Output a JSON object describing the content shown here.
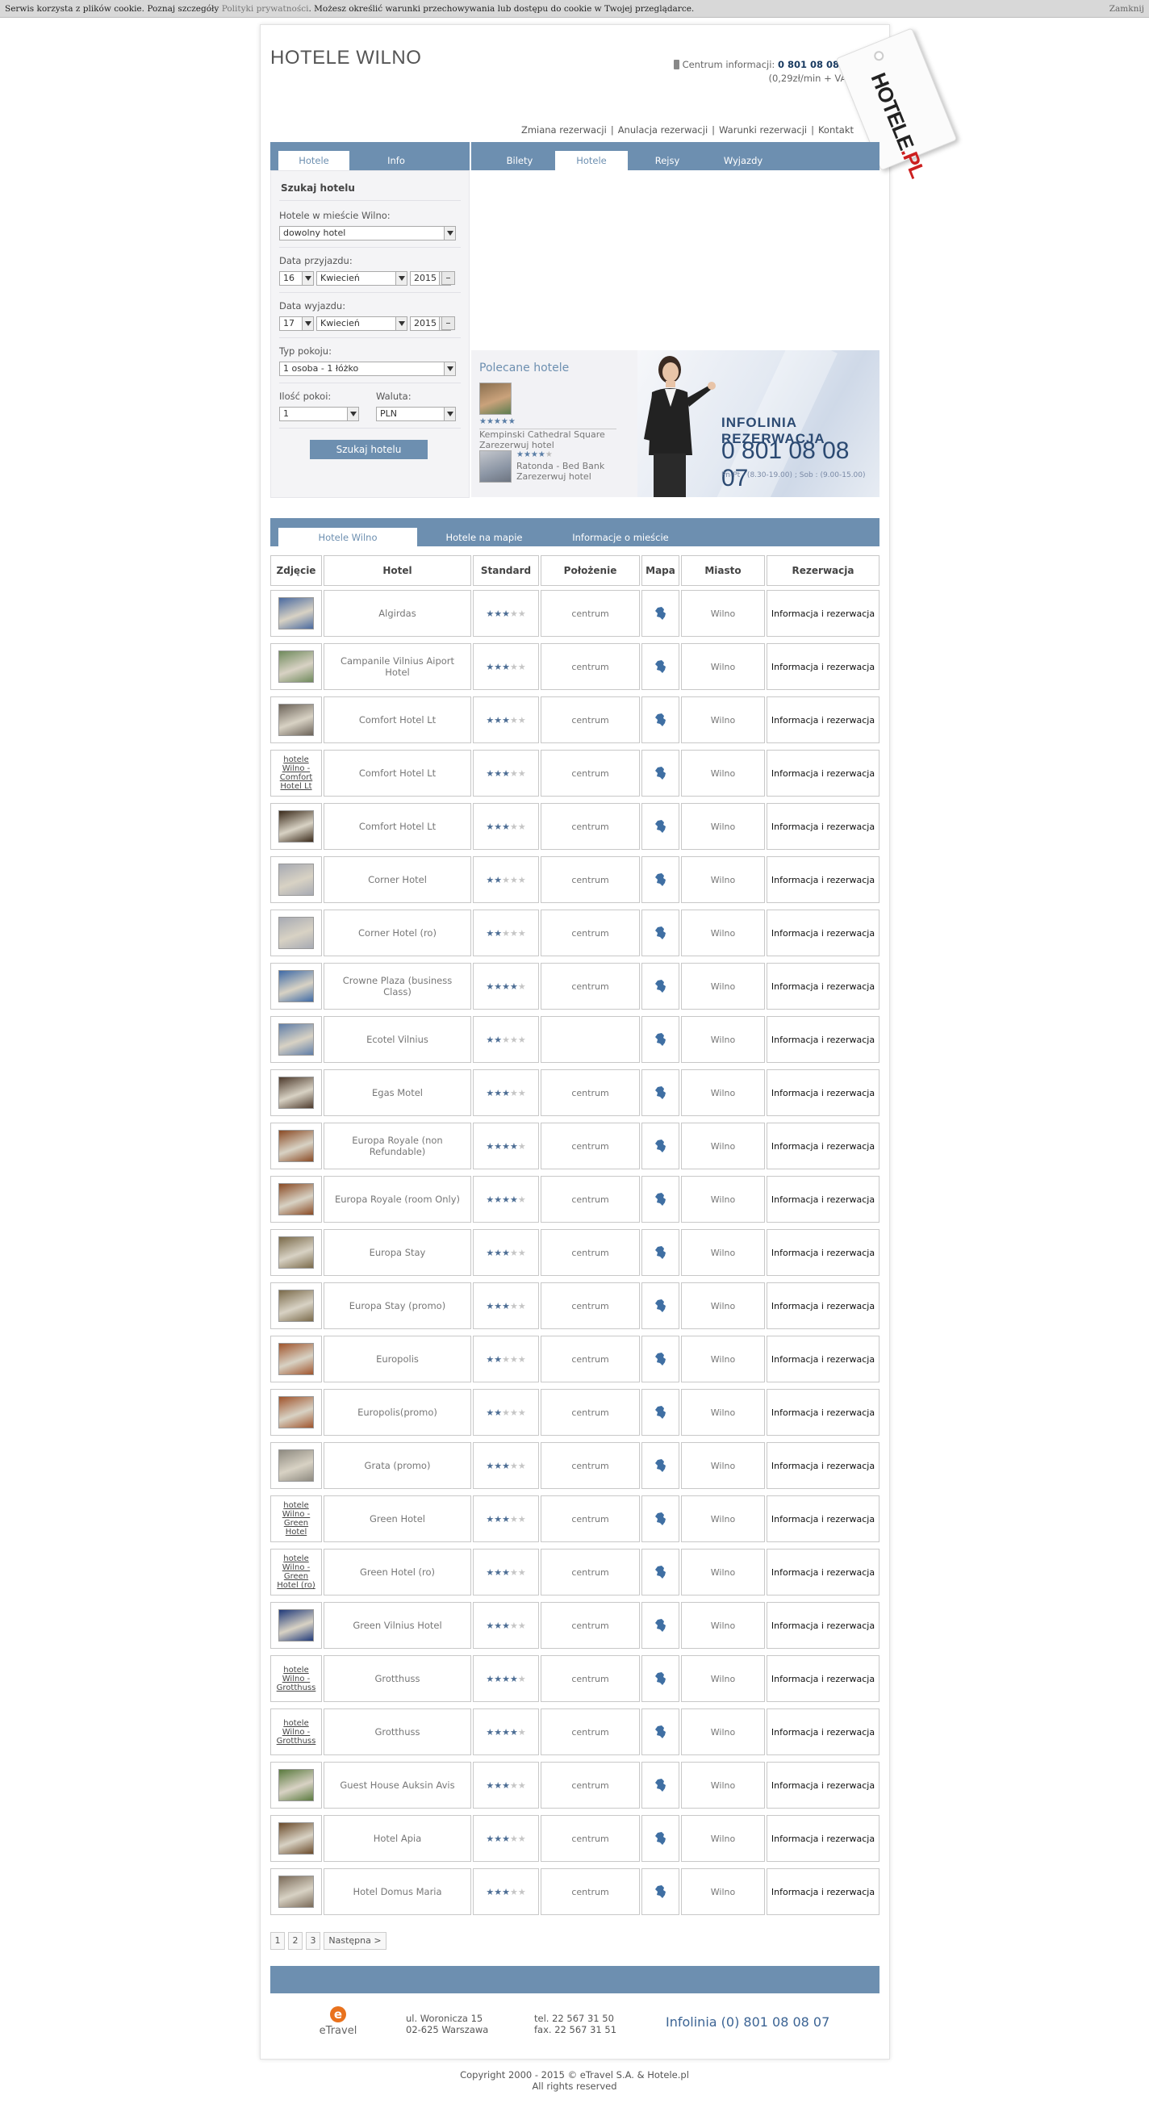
{
  "cookie": {
    "text_before": "Serwis korzysta z plików cookie. Poznaj szczegóły ",
    "link": "Polityki prywatności",
    "text_after": ". Możesz określić warunki przechowywania lub dostępu do cookie w Twojej przeglądarce.",
    "close": "Zamknij"
  },
  "header": {
    "title": "HOTELE WILNO",
    "contact_label": "Centrum informacji: ",
    "contact_phone": "0 801 08 08 07",
    "contact_price": "(0,29zł/min + VAT)",
    "logo_text": "HOTELE",
    "logo_suffix": ".PL"
  },
  "top_links": [
    "Zmiana rezerwacji",
    "Anulacja rezerwacji",
    "Warunki rezerwacji",
    "Kontakt"
  ],
  "left_tabs": [
    "Hotele",
    "Info"
  ],
  "right_tabs": [
    "Bilety",
    "Hotele",
    "Rejsy",
    "Wyjazdy"
  ],
  "search": {
    "title": "Szukaj hotelu",
    "hotel_label": "Hotele w mieście Wilno:",
    "hotel_value": "dowolny hotel",
    "arrival_label": "Data przyjazdu:",
    "arrival": {
      "day": "16",
      "month": "Kwiecień",
      "year": "2015"
    },
    "departure_label": "Data wyjazdu:",
    "departure": {
      "day": "17",
      "month": "Kwiecień",
      "year": "2015"
    },
    "room_type_label": "Typ pokoju:",
    "room_type": "1 osoba - 1 łóżko",
    "rooms_label": "Ilość pokoi:",
    "rooms": "1",
    "currency_label": "Waluta:",
    "currency": "PLN",
    "button": "Szukaj hotelu"
  },
  "recommended": {
    "title": "Polecane hotele",
    "items": [
      {
        "name": "Kempinski Cathedral Square",
        "action": "Zarezerwuj hotel",
        "stars": 5
      },
      {
        "name": "Ratonda - Bed Bank",
        "action": "Zarezerwuj hotel",
        "stars": 4
      }
    ]
  },
  "banner": {
    "title": "INFOLINIA REZERWACJA",
    "phone": "0 801 08 08 07",
    "hours": "Pn-Pt : (8.30-19.00) ;  Sob : (9.00-15.00)"
  },
  "list_tabs": [
    "Hotele Wilno",
    "Hotele na mapie",
    "Informacje o mieście"
  ],
  "table": {
    "headers": [
      "Zdjęcie",
      "Hotel",
      "Standard",
      "Położenie",
      "Mapa",
      "Miasto",
      "Rezerwacja"
    ],
    "reserve_label": "Informacja i rezerwacja",
    "rows": [
      {
        "photo": "img",
        "photo_alt": "",
        "name": "Algirdas",
        "stars": 3,
        "position": "centrum",
        "city": "Wilno",
        "img_color": "#4a6aa0"
      },
      {
        "photo": "img",
        "photo_alt": "",
        "name": "Campanile Vilnius Aiport Hotel",
        "stars": 3,
        "position": "centrum",
        "city": "Wilno",
        "img_color": "#6f8a5c"
      },
      {
        "photo": "img",
        "photo_alt": "",
        "name": "Comfort Hotel Lt",
        "stars": 3,
        "position": "centrum",
        "city": "Wilno",
        "img_color": "#6b6258"
      },
      {
        "photo": "alt",
        "photo_alt": "hotele Wilno - Comfort Hotel Lt",
        "name": "Comfort Hotel Lt",
        "stars": 3,
        "position": "centrum",
        "city": "Wilno",
        "img_color": ""
      },
      {
        "photo": "img",
        "photo_alt": "",
        "name": "Comfort Hotel Lt",
        "stars": 3,
        "position": "centrum",
        "city": "Wilno",
        "img_color": "#3a2a1a"
      },
      {
        "photo": "img",
        "photo_alt": "",
        "name": "Corner Hotel",
        "stars": 2,
        "position": "centrum",
        "city": "Wilno",
        "img_color": "#a7aab3"
      },
      {
        "photo": "img",
        "photo_alt": "",
        "name": "Corner Hotel (ro)",
        "stars": 2,
        "position": "centrum",
        "city": "Wilno",
        "img_color": "#a7aab3"
      },
      {
        "photo": "img",
        "photo_alt": "",
        "name": "Crowne Plaza (business Class)",
        "stars": 4,
        "position": "centrum",
        "city": "Wilno",
        "img_color": "#3e6aa6"
      },
      {
        "photo": "img",
        "photo_alt": "",
        "name": "Ecotel Vilnius",
        "stars": 2,
        "position": "",
        "city": "Wilno",
        "img_color": "#5f7ea8"
      },
      {
        "photo": "img",
        "photo_alt": "",
        "name": "Egas Motel",
        "stars": 3,
        "position": "centrum",
        "city": "Wilno",
        "img_color": "#4d3a2c"
      },
      {
        "photo": "img",
        "photo_alt": "",
        "name": "Europa Royale (non Refundable)",
        "stars": 4,
        "position": "centrum",
        "city": "Wilno",
        "img_color": "#8a4a24"
      },
      {
        "photo": "img",
        "photo_alt": "",
        "name": "Europa Royale (room Only)",
        "stars": 4,
        "position": "centrum",
        "city": "Wilno",
        "img_color": "#8a4a24"
      },
      {
        "photo": "img",
        "photo_alt": "",
        "name": "Europa Stay",
        "stars": 3,
        "position": "centrum",
        "city": "Wilno",
        "img_color": "#7a6a4a"
      },
      {
        "photo": "img",
        "photo_alt": "",
        "name": "Europa Stay (promo)",
        "stars": 3,
        "position": "centrum",
        "city": "Wilno",
        "img_color": "#7a6a4a"
      },
      {
        "photo": "img",
        "photo_alt": "",
        "name": "Europolis",
        "stars": 2,
        "position": "centrum",
        "city": "Wilno",
        "img_color": "#a0542c"
      },
      {
        "photo": "img",
        "photo_alt": "",
        "name": "Europolis(promo)",
        "stars": 2,
        "position": "centrum",
        "city": "Wilno",
        "img_color": "#a0542c"
      },
      {
        "photo": "img",
        "photo_alt": "",
        "name": "Grata (promo)",
        "stars": 3,
        "position": "centrum",
        "city": "Wilno",
        "img_color": "#8e8a80"
      },
      {
        "photo": "alt",
        "photo_alt": "hotele Wilno - Green Hotel",
        "name": "Green Hotel",
        "stars": 3,
        "position": "centrum",
        "city": "Wilno",
        "img_color": ""
      },
      {
        "photo": "alt",
        "photo_alt": "hotele Wilno - Green Hotel (ro)",
        "name": "Green Hotel (ro)",
        "stars": 3,
        "position": "centrum",
        "city": "Wilno",
        "img_color": ""
      },
      {
        "photo": "img",
        "photo_alt": "",
        "name": "Green Vilnius Hotel",
        "stars": 3,
        "position": "centrum",
        "city": "Wilno",
        "img_color": "#203a7a"
      },
      {
        "photo": "alt",
        "photo_alt": "hotele Wilno - Grotthuss",
        "name": "Grotthuss",
        "stars": 4,
        "position": "centrum",
        "city": "Wilno",
        "img_color": ""
      },
      {
        "photo": "alt",
        "photo_alt": "hotele Wilno - Grotthuss",
        "name": "Grotthuss",
        "stars": 4,
        "position": "centrum",
        "city": "Wilno",
        "img_color": ""
      },
      {
        "photo": "img",
        "photo_alt": "",
        "name": "Guest House Auksin Avis",
        "stars": 3,
        "position": "centrum",
        "city": "Wilno",
        "img_color": "#5a7a3e"
      },
      {
        "photo": "img",
        "photo_alt": "",
        "name": "Hotel Apia",
        "stars": 3,
        "position": "centrum",
        "city": "Wilno",
        "img_color": "#6a4a2a"
      },
      {
        "photo": "img",
        "photo_alt": "",
        "name": "Hotel Domus Maria",
        "stars": 3,
        "position": "centrum",
        "city": "Wilno",
        "img_color": "#7a6a58"
      }
    ]
  },
  "pager": [
    "1",
    "2",
    "3",
    "Następna >"
  ],
  "footer": {
    "brand": "eTravel",
    "addr1": "ul. Woronicza 15",
    "addr2": "02-625 Warszawa",
    "tel": "tel. 22 567 31 50",
    "fax": "fax. 22 567 31 51",
    "infolinia": "Infolinia  (0) 801 08 08 07",
    "copyright1": "Copyright 2000 - 2015 © eTravel S.A. & Hotele.pl",
    "copyright2": "All rights reserved"
  },
  "colors": {
    "accent": "#6d8fb0",
    "star_on": "#4d6e95",
    "star_off": "#c6c6c6",
    "logo_red": "#cc1f1f",
    "etravel_orange": "#e9721d"
  }
}
